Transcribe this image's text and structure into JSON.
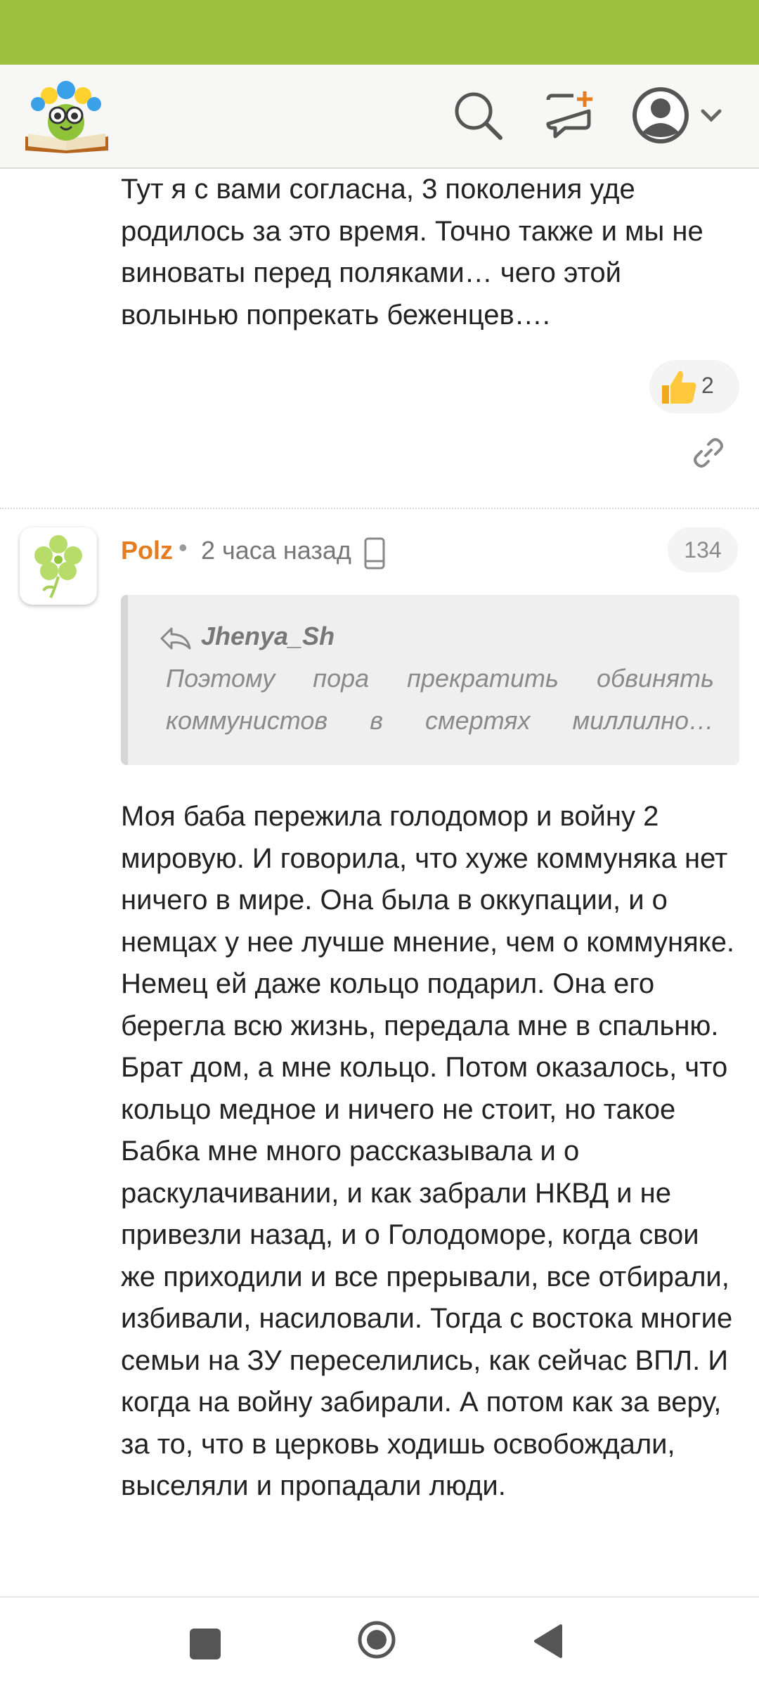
{
  "colors": {
    "status_bar": "#9dc13f",
    "accent": "#e57c1f",
    "text": "#222222",
    "muted": "#8a8a8a"
  },
  "header": {
    "logo_icon": "book-owl-logo-icon",
    "search_icon": "search-icon",
    "new_message_icon": "chat-plus-icon",
    "avatar_icon": "user-avatar-icon",
    "menu_icon": "chevron-down-icon"
  },
  "comment_prev": {
    "text": "Тут я с вами согласна, 3 поколения уде родилось за это время. Точно также и мы не виноваты перед поляками… чего этой волынью попрекать беженцев….",
    "likes": "2"
  },
  "comment": {
    "username": "Polz",
    "separator": "•",
    "time": "2 часа назад",
    "number": "134",
    "quote": {
      "author": "Jhenya_Sh",
      "line1": [
        "Поэтому",
        "пора",
        "прекратить",
        "обвинять"
      ],
      "line2": [
        "коммунистов",
        "в",
        "смертях",
        "миллилно…"
      ]
    },
    "text": "Моя баба пережила голодомор и войну 2 мировую. И говорила, что хуже коммуняка нет ничего в мире. Она была в оккупации, и о немцах у нее лучше мнение, чем о коммуняке. Немец ей даже кольцо подарил. Она его берегла всю жизнь, передала мне в спальню. Брат дом, а мне кольцо. Потом оказалось, что кольцо медное и ничего не стоит, но такое Бабка мне много рассказывала и о раскулачивании, и как забрали НКВД и не привезли назад, и о Голодоморе, когда свои же приходили и все прерывали, все отбирали, избивали, насиловали. Тогда с востока многие семьи на ЗУ переселились, как сейчас ВПЛ. И когда на войну забирали. А потом как за веру, за то, что в церковь ходишь освобождали, выселяли и пропадали люди."
  }
}
